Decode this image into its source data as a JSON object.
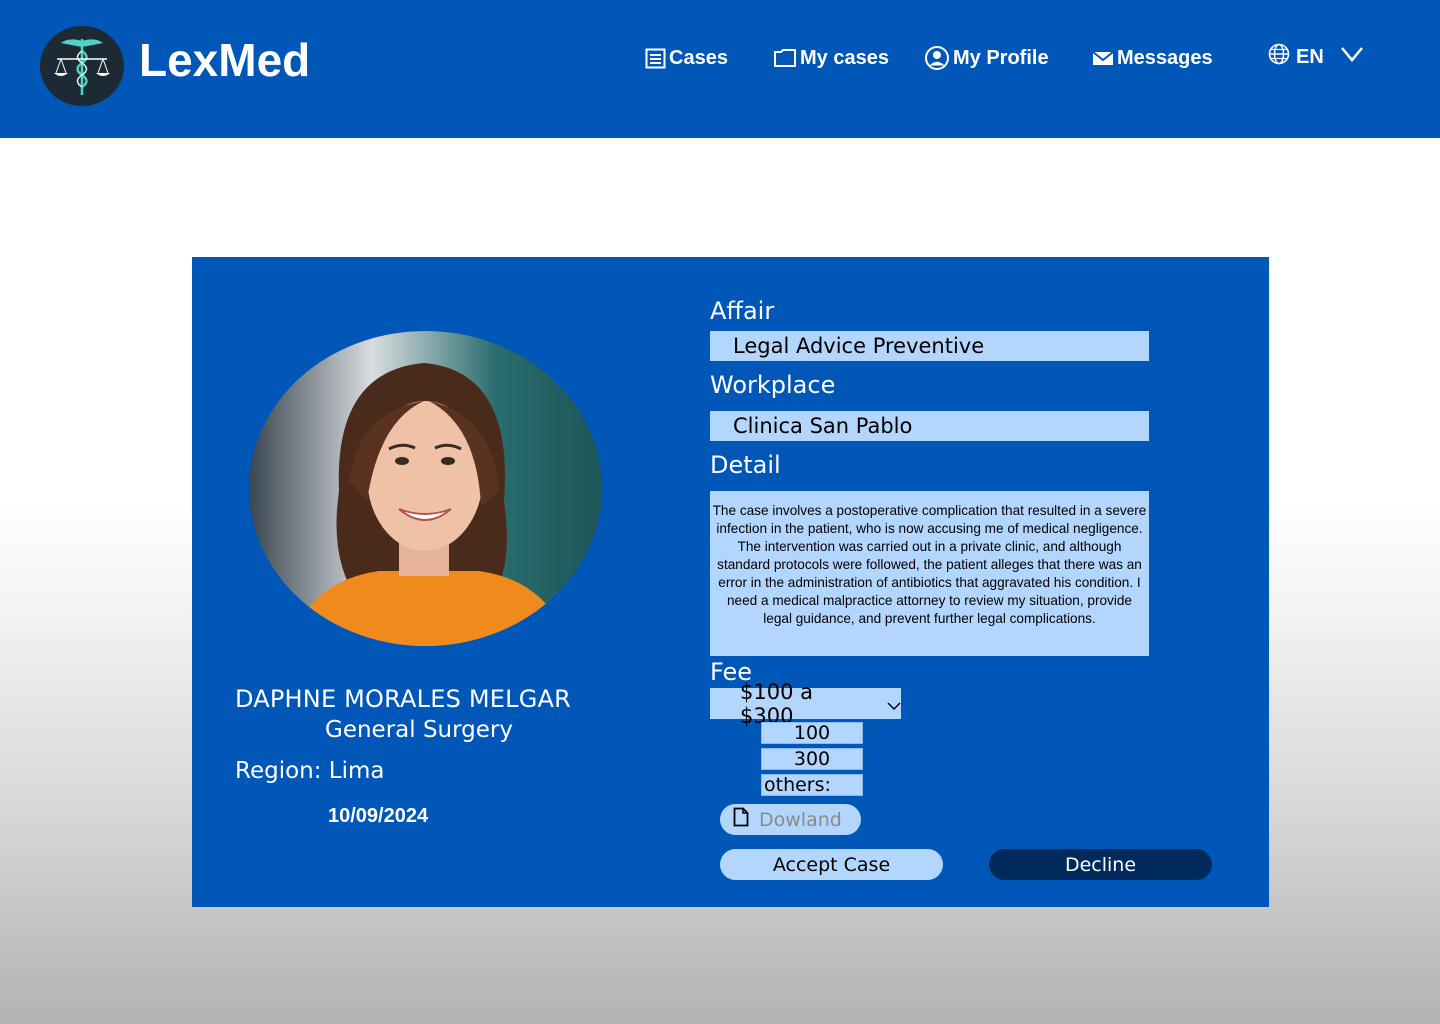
{
  "header": {
    "brand": "LexMed",
    "bg_color": "#0057b7",
    "nav": [
      {
        "label": "Cases",
        "icon": "list-icon"
      },
      {
        "label": "My cases",
        "icon": "folder-icon"
      },
      {
        "label": "My Profile",
        "icon": "user-circle-icon"
      },
      {
        "label": "Messages",
        "icon": "envelope-icon"
      }
    ],
    "language": {
      "label": "EN",
      "icon": "globe-icon"
    }
  },
  "case": {
    "doctor_name": "DAPHNE MORALES MELGAR",
    "specialty": "General Surgery",
    "region": "Region: Lima",
    "date": "10/09/2024",
    "affair_label": "Affair",
    "affair_value": "Legal Advice Preventive",
    "workplace_label": "Workplace",
    "workplace_value": "Clinica San Pablo",
    "detail_label": "Detail",
    "detail_text": "The case involves a postoperative complication that resulted in a severe infection in the patient, who is now accusing me of medical negligence. The intervention was carried out in a private clinic, and although standard protocols were followed, the patient alleges that there was an error in the administration of antibiotics that aggravated his condition. I need a medical malpractice attorney to review my situation, provide legal guidance, and prevent further legal complications.",
    "fee_label": "Fee",
    "fee_selected": "$100 a $300",
    "fee_options": [
      "100",
      "300",
      "others:"
    ],
    "download_label": "Dowland",
    "accept_label": "Accept Case",
    "decline_label": "Decline"
  },
  "colors": {
    "primary": "#0057b7",
    "field": "#b3d6ff",
    "decline": "#002a5c"
  }
}
